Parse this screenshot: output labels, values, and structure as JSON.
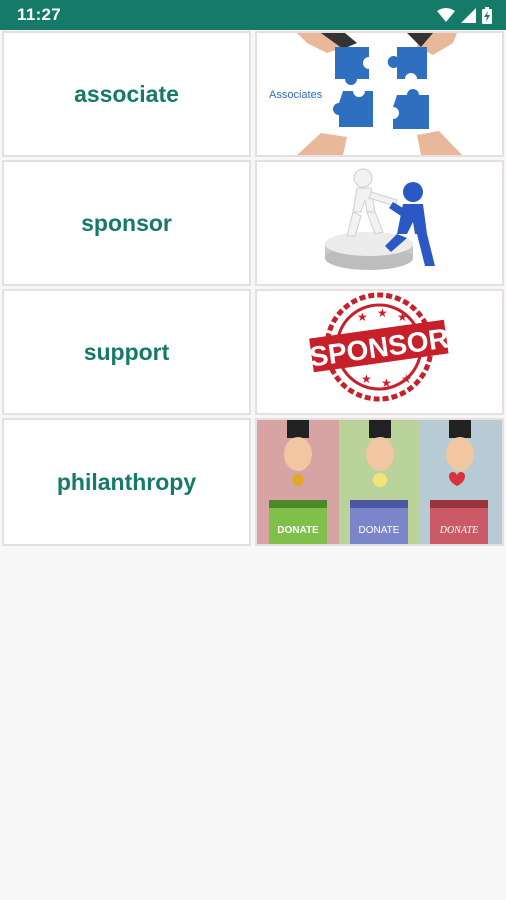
{
  "status_bar": {
    "time": "11:27",
    "icons": [
      "wifi-icon",
      "signal-icon",
      "battery-charging-icon"
    ],
    "color": "#157a68"
  },
  "accent_color": "#157a68",
  "cards": [
    {
      "word": "associate",
      "image": "puzzle-hands-image",
      "image_caption": "Associates"
    },
    {
      "word": "sponsor",
      "image": "figures-helping-image"
    },
    {
      "word": "support",
      "image": "sponsor-stamp-image",
      "image_caption": "SPONSOR"
    },
    {
      "word": "philanthropy",
      "image": "donation-boxes-image",
      "image_captions": [
        "DONATE",
        "DONATE",
        "DONATE"
      ]
    }
  ]
}
